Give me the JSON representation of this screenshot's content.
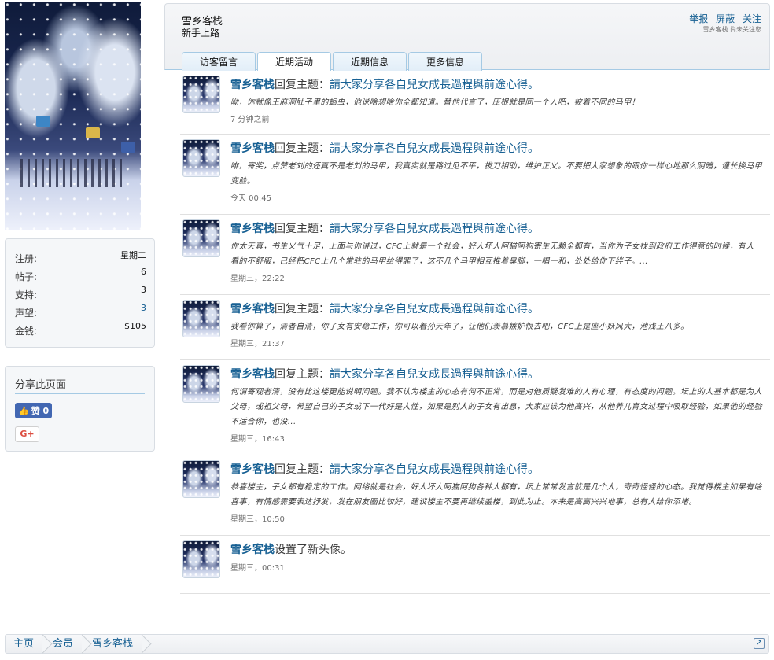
{
  "profile": {
    "name": "雪乡客栈",
    "title": "新手上路",
    "actions": [
      "举报",
      "屏蔽",
      "关注"
    ],
    "status": "雪乡客栈 尚未关注您"
  },
  "stats": [
    {
      "label": "注册:",
      "value": "星期二"
    },
    {
      "label": "帖子:",
      "value": "6"
    },
    {
      "label": "支持:",
      "value": "3"
    },
    {
      "label": "声望:",
      "value": "3"
    },
    {
      "label": "金钱:",
      "value": "$105"
    }
  ],
  "share": {
    "title": "分享此页面",
    "like_label": "赞 0",
    "gplus_label": "G+"
  },
  "tabs": [
    "访客留言",
    "近期活动",
    "近期信息",
    "更多信息"
  ],
  "feed": [
    {
      "user": "雪乡客栈",
      "action": "回复主题：",
      "topic": "請大家分享各自兒女成長過程與前途心得。",
      "snippet": "呦，你就像王麻洞肚子里的蛔虫，他说啥想啥你全都知道。替他代言了，压根就是同一个人吧，披着不同的马甲！",
      "time": "7 分钟之前"
    },
    {
      "user": "雪乡客栈",
      "action": "回复主题：",
      "topic": "請大家分享各自兒女成長過程與前途心得。",
      "snippet": "啡，寄奖，点赞老刘的还真不是老刘的马甲，我真实就是路过见不平，拔刀相助，维护正义。不要把人家想象的跟你一样心地那么阴暗，谨长换马甲变脸。",
      "time": "今天 00:45"
    },
    {
      "user": "雪乡客栈",
      "action": "回复主题：",
      "topic": "請大家分享各自兒女成長過程與前途心得。",
      "snippet": "你太天真，书生义气十足，上面与你讲过，CFC上就是一个社会，好人坏人阿猫阿狗寄生无赖全都有，当你为子女找到政府工作得意的时候，有人看的不舒服，已经把CFC上几个常驻的马甲给得罪了，这不几个马甲相互推着臭脚，一唱一和，处处给你下绊子。...",
      "time": "星期三，22:22"
    },
    {
      "user": "雪乡客栈",
      "action": "回复主题：",
      "topic": "請大家分享各自兒女成長過程與前途心得。",
      "snippet": "我看你算了，清者自清，你子女有安稳工作，你可以着孙天年了，让他们羡慕嫉妒恨去吧，CFC上是座小妖风大，池浅王八多。",
      "time": "星期三，21:37"
    },
    {
      "user": "雪乡客栈",
      "action": "回复主题：",
      "topic": "請大家分享各自兒女成長過程與前途心得。",
      "snippet": "何谓寄观者清，没有比这楼更能说明问题。我不认为楼主的心态有何不正常，而是对他质疑发难的人有心理，有态度的问题。坛上的人基本都是为人父母，或祖父母，希望自己的子女或下一代好是人性，如果是别人的子女有出息，大家应该为他高兴，从他养儿育女过程中吸取经验，如果他的经验不适合你，也没...",
      "time": "星期三，16:43"
    },
    {
      "user": "雪乡客栈",
      "action": "回复主题：",
      "topic": "請大家分享各自兒女成長過程與前途心得。",
      "snippet": "恭喜楼主，子女都有稳定的工作。网络就是社会，好人坏人阿猫阿狗各种人都有，坛上常常发言就是几个人，奇奇怪怪的心态。我觉得楼主如果有啥喜事，有情感需要表达抒发，发在朋友圈比较好，建议楼主不要再继续盖楼，到此为止。本来是高高兴兴地事，总有人给你添堵。",
      "time": "星期三，10:50"
    },
    {
      "user": "雪乡客栈",
      "action": "设置了新头像。",
      "topic": "",
      "snippet": "",
      "time": "星期三，00:31"
    }
  ],
  "breadcrumb": [
    "主页",
    "会员",
    "雪乡客栈"
  ]
}
